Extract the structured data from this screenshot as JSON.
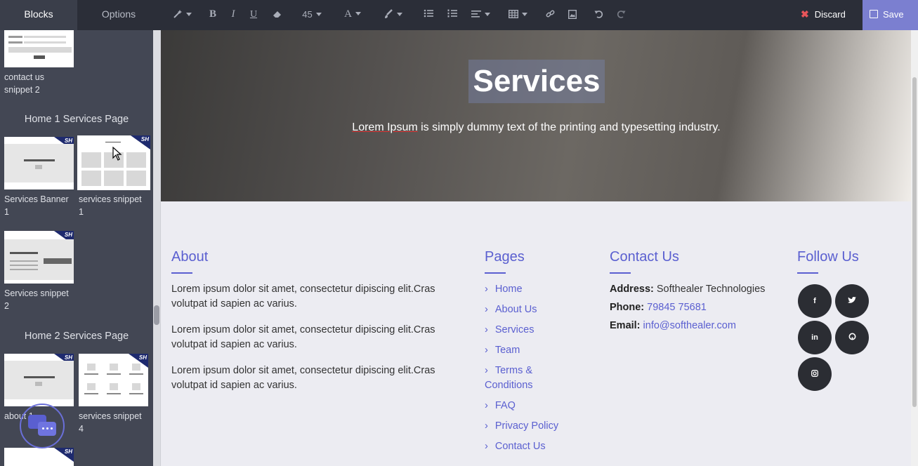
{
  "toolbar": {
    "tab_blocks": "Blocks",
    "tab_options": "Options",
    "font_size": "45",
    "discard_label": "Discard",
    "save_label": "Save"
  },
  "sidebar": {
    "item_contact_us_snippet_2": "contact us snippet 2",
    "section_home1": "Home 1 Services Page",
    "item_services_banner_1": "Services Banner 1",
    "item_services_snippet_1": "services snippet 1",
    "item_services_snippet_2": "Services snippet 2",
    "section_home2": "Home 2 Services Page",
    "item_about_1": "about 1",
    "item_services_snippet_4": "services snippet 4",
    "badge": "SH"
  },
  "hero": {
    "title": "Services",
    "subtitle_lead": "Lorem Ipsum",
    "subtitle_rest": " is simply dummy text of the printing and typesetting industry."
  },
  "footer": {
    "about": {
      "heading": "About",
      "paragraphs": [
        "Lorem ipsum dolor sit amet, consectetur dipiscing elit.Cras volutpat id sapien ac varius.",
        "Lorem ipsum dolor sit amet, consectetur dipiscing elit.Cras volutpat id sapien ac varius.",
        "Lorem ipsum dolor sit amet, consectetur dipiscing elit.Cras volutpat id sapien ac varius."
      ]
    },
    "pages": {
      "heading": "Pages",
      "links": [
        "Home",
        "About Us",
        "Services",
        "Team",
        "Terms & Conditions",
        "FAQ",
        "Privacy Policy",
        "Contact Us"
      ]
    },
    "contact": {
      "heading": "Contact Us",
      "address_label": "Address:",
      "address_value": "Softhealer Technologies",
      "phone_label": "Phone:",
      "phone_value": "79845 75681",
      "email_label": "Email:",
      "email_value": "info@softhealer.com"
    },
    "follow": {
      "heading": "Follow Us",
      "icons": [
        "facebook-icon",
        "twitter-icon",
        "linkedin-icon",
        "github-icon",
        "instagram-icon"
      ]
    }
  },
  "colors": {
    "accent": "#5a5fd0",
    "toolbar_bg": "#2b2e38",
    "sidebar_bg": "#434754",
    "save_bg": "#7b7fd0",
    "discard_x": "#e8555a"
  }
}
